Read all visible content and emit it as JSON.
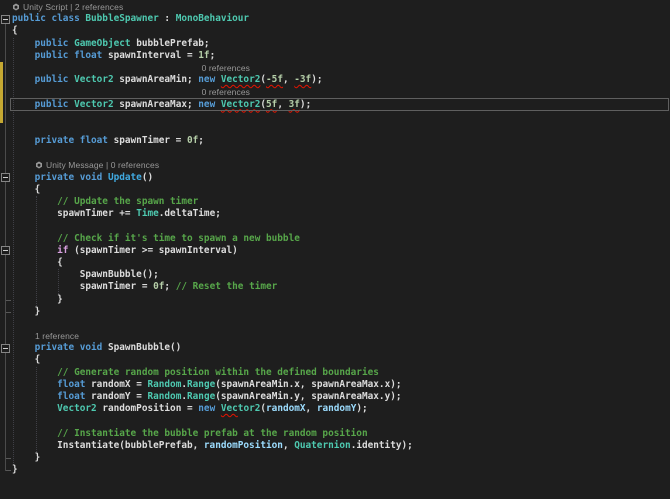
{
  "colors": {
    "background": "#1e1e1e",
    "keyword": "#569cd6",
    "control": "#d8a0df",
    "type": "#4ec9b0",
    "number": "#b5cea8",
    "comment": "#57a64a",
    "text": "#dcdcdc",
    "local": "#9cdcfe",
    "unityMethod": "#40a9e0",
    "codelens": "#999999",
    "squiggle": "#e51400",
    "currentLineBorder": "#5f5f5f",
    "changeBar": "#c5a832"
  },
  "editor": {
    "lines": [
      {
        "kind": "codelens",
        "cols": 0,
        "icon": true,
        "segments": [
          {
            "text": "Unity Script"
          },
          {
            "text": " | "
          },
          {
            "text": "2 references",
            "link": true
          }
        ]
      },
      {
        "kind": "code",
        "fold": true,
        "tokens": [
          [
            "public class ",
            "keyword"
          ],
          [
            "BubbleSpawner",
            "type"
          ],
          [
            " : ",
            "text"
          ],
          [
            "MonoBehaviour",
            "type"
          ]
        ]
      },
      {
        "kind": "code",
        "tokens": [
          [
            "{",
            "text"
          ]
        ]
      },
      {
        "kind": "code",
        "tokens": [
          [
            "    ",
            "text"
          ],
          [
            "public ",
            "keyword"
          ],
          [
            "GameObject",
            "type"
          ],
          [
            " bubblePrefab;",
            "text"
          ]
        ]
      },
      {
        "kind": "code",
        "tokens": [
          [
            "    ",
            "text"
          ],
          [
            "public float",
            "keyword"
          ],
          [
            " spawnInterval = ",
            "text"
          ],
          [
            "1f",
            "number"
          ],
          [
            ";",
            "text"
          ]
        ]
      },
      {
        "kind": "codelens",
        "cols": 33,
        "segments": [
          {
            "text": "0 references",
            "link": true
          }
        ]
      },
      {
        "kind": "code",
        "tokens": [
          [
            "    ",
            "text"
          ],
          [
            "public ",
            "keyword"
          ],
          [
            "Vector2",
            "type"
          ],
          [
            " spawnAreaMin; ",
            "text"
          ],
          [
            "new ",
            "keyword"
          ],
          [
            "Vector2",
            "type",
            "sq"
          ],
          [
            "(",
            "text"
          ],
          [
            "-5f",
            "number",
            "sq"
          ],
          [
            ", ",
            "text"
          ],
          [
            "-3f",
            "number",
            "sq"
          ],
          [
            ");",
            "text"
          ]
        ]
      },
      {
        "kind": "codelens",
        "cols": 33,
        "segments": [
          {
            "text": "0 references",
            "link": true
          }
        ]
      },
      {
        "kind": "code",
        "current": true,
        "tokens": [
          [
            "    ",
            "text"
          ],
          [
            "public ",
            "keyword"
          ],
          [
            "Vector2",
            "type"
          ],
          [
            " spawnAreaMax; ",
            "text"
          ],
          [
            "new ",
            "keyword"
          ],
          [
            "Vector2",
            "type",
            "sq"
          ],
          [
            "(",
            "text"
          ],
          [
            "5f",
            "number",
            "sq"
          ],
          [
            ", ",
            "text"
          ],
          [
            "3f",
            "number",
            "sq"
          ],
          [
            ");",
            "text"
          ]
        ]
      },
      {
        "kind": "blank"
      },
      {
        "kind": "blank"
      },
      {
        "kind": "code",
        "tokens": [
          [
            "    ",
            "text"
          ],
          [
            "private float",
            "keyword"
          ],
          [
            " spawnTimer = ",
            "text"
          ],
          [
            "0f",
            "number"
          ],
          [
            ";",
            "text"
          ]
        ]
      },
      {
        "kind": "blank"
      },
      {
        "kind": "codelens",
        "cols": 4,
        "icon": true,
        "segments": [
          {
            "text": "Unity Message"
          },
          {
            "text": " | "
          },
          {
            "text": "0 references",
            "link": true
          }
        ]
      },
      {
        "kind": "code",
        "fold": true,
        "tokens": [
          [
            "    ",
            "text"
          ],
          [
            "private void ",
            "keyword"
          ],
          [
            "Update",
            "unityMethod"
          ],
          [
            "()",
            "text"
          ]
        ]
      },
      {
        "kind": "code",
        "tokens": [
          [
            "    {",
            "text"
          ]
        ]
      },
      {
        "kind": "code",
        "tokens": [
          [
            "        ",
            "text"
          ],
          [
            "// Update the spawn timer",
            "comment"
          ]
        ]
      },
      {
        "kind": "code",
        "tokens": [
          [
            "        spawnTimer += ",
            "text"
          ],
          [
            "Time",
            "type"
          ],
          [
            ".deltaTime;",
            "text"
          ]
        ]
      },
      {
        "kind": "blank"
      },
      {
        "kind": "code",
        "tokens": [
          [
            "        ",
            "text"
          ],
          [
            "// Check if it's time to spawn a new bubble",
            "comment"
          ]
        ]
      },
      {
        "kind": "code",
        "fold": true,
        "tokens": [
          [
            "        ",
            "text"
          ],
          [
            "if",
            "control"
          ],
          [
            " (spawnTimer >= spawnInterval)",
            "text"
          ]
        ]
      },
      {
        "kind": "code",
        "tokens": [
          [
            "        {",
            "text"
          ]
        ]
      },
      {
        "kind": "code",
        "tokens": [
          [
            "            SpawnBubble();",
            "text"
          ]
        ]
      },
      {
        "kind": "code",
        "tokens": [
          [
            "            spawnTimer = ",
            "text"
          ],
          [
            "0f",
            "number"
          ],
          [
            "; ",
            "text"
          ],
          [
            "// Reset the timer",
            "comment"
          ]
        ]
      },
      {
        "kind": "code",
        "tick": true,
        "tokens": [
          [
            "        }",
            "text"
          ]
        ]
      },
      {
        "kind": "code",
        "tick": true,
        "tokens": [
          [
            "    }",
            "text"
          ]
        ]
      },
      {
        "kind": "blank"
      },
      {
        "kind": "codelens",
        "cols": 4,
        "segments": [
          {
            "text": "1 reference",
            "link": true
          }
        ]
      },
      {
        "kind": "code",
        "fold": true,
        "tokens": [
          [
            "    ",
            "text"
          ],
          [
            "private void ",
            "keyword"
          ],
          [
            "SpawnBubble()",
            "text"
          ]
        ]
      },
      {
        "kind": "code",
        "tokens": [
          [
            "    {",
            "text"
          ]
        ]
      },
      {
        "kind": "code",
        "tokens": [
          [
            "        ",
            "text"
          ],
          [
            "// Generate random position within the defined boundaries",
            "comment"
          ]
        ]
      },
      {
        "kind": "code",
        "tokens": [
          [
            "        ",
            "text"
          ],
          [
            "float",
            "keyword"
          ],
          [
            " randomX = ",
            "text"
          ],
          [
            "Random",
            "type"
          ],
          [
            ".",
            "text"
          ],
          [
            "Range",
            "type"
          ],
          [
            "(spawnAreaMin.x, spawnAreaMax.x);",
            "text"
          ]
        ]
      },
      {
        "kind": "code",
        "tokens": [
          [
            "        ",
            "text"
          ],
          [
            "float",
            "keyword"
          ],
          [
            " randomY = ",
            "text"
          ],
          [
            "Random",
            "type"
          ],
          [
            ".",
            "text"
          ],
          [
            "Range",
            "type"
          ],
          [
            "(spawnAreaMin.y, spawnAreaMax.y);",
            "text"
          ]
        ]
      },
      {
        "kind": "code",
        "tokens": [
          [
            "        ",
            "text"
          ],
          [
            "Vector2",
            "type"
          ],
          [
            " randomPosition = ",
            "text"
          ],
          [
            "new ",
            "keyword"
          ],
          [
            "Vec",
            "type",
            "sq"
          ],
          [
            "tor2",
            "type"
          ],
          [
            "(",
            "text"
          ],
          [
            "randomX",
            "local"
          ],
          [
            ", ",
            "text"
          ],
          [
            "randomY",
            "local"
          ],
          [
            ");",
            "text"
          ]
        ]
      },
      {
        "kind": "blank"
      },
      {
        "kind": "code",
        "tokens": [
          [
            "        ",
            "text"
          ],
          [
            "// Instantiate the bubble prefab at the random position",
            "comment"
          ]
        ]
      },
      {
        "kind": "code",
        "tokens": [
          [
            "        Instantiate(bubblePrefab, ",
            "text"
          ],
          [
            "randomPosition",
            "local"
          ],
          [
            ", ",
            "text"
          ],
          [
            "Quaternion",
            "type"
          ],
          [
            ".identity);",
            "text"
          ]
        ]
      },
      {
        "kind": "code",
        "tick": true,
        "tokens": [
          [
            "    }",
            "text"
          ]
        ]
      },
      {
        "kind": "code",
        "tick": true,
        "tokens": [
          [
            "}",
            "text"
          ]
        ]
      }
    ]
  }
}
